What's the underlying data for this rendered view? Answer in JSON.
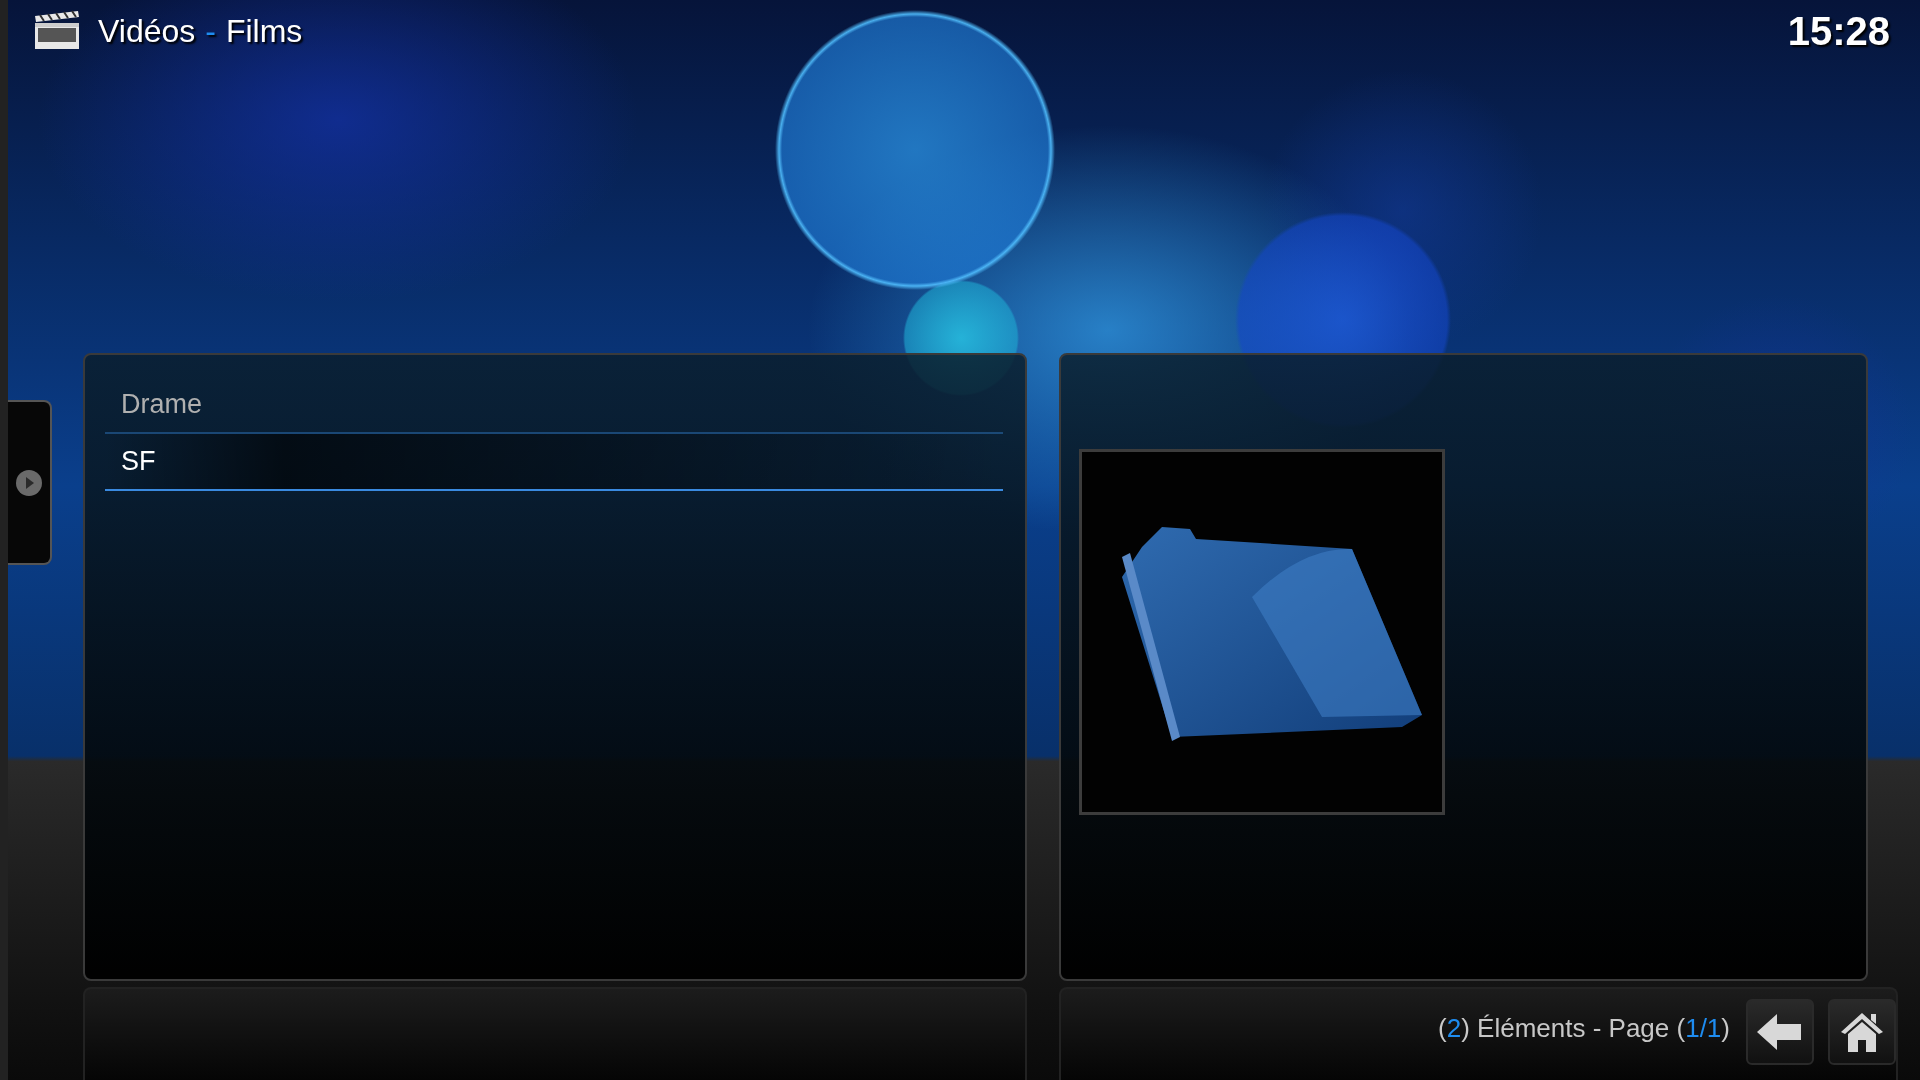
{
  "header": {
    "title": [
      {
        "text": "Vidéos",
        "accent": false
      },
      {
        "text": "-",
        "accent": true
      },
      {
        "text": "Films",
        "accent": false
      }
    ],
    "clock": "15:28"
  },
  "list": {
    "items": [
      {
        "label": "Drame",
        "selected": false
      },
      {
        "label": "SF",
        "selected": true
      }
    ]
  },
  "status": [
    {
      "text": "(",
      "accent": false
    },
    {
      "text": "2",
      "accent": true
    },
    {
      "text": ") Éléments - Page (",
      "accent": false
    },
    {
      "text": "1/1",
      "accent": true
    },
    {
      "text": ")",
      "accent": false
    }
  ]
}
